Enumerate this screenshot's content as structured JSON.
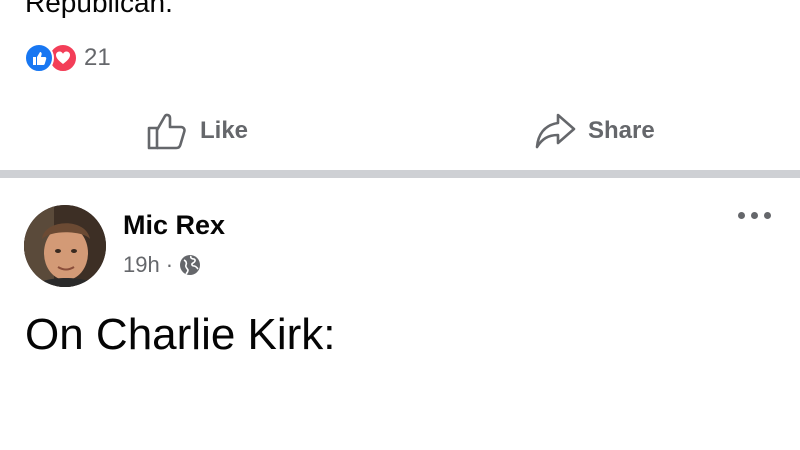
{
  "previous_post": {
    "text_fragment": "Republican.",
    "reaction_count": "21",
    "reactions": [
      "like-icon",
      "love-icon"
    ],
    "actions": {
      "like_label": "Like",
      "share_label": "Share"
    }
  },
  "post": {
    "author": "Mic Rex",
    "timestamp": "19h",
    "separator": "·",
    "audience_icon": "globe-icon",
    "text": "On Charlie Kirk:"
  },
  "colors": {
    "like_blue": "#1877f2",
    "love_red": "#f33e58",
    "secondary_text": "#65676b",
    "divider": "#ced0d4"
  }
}
